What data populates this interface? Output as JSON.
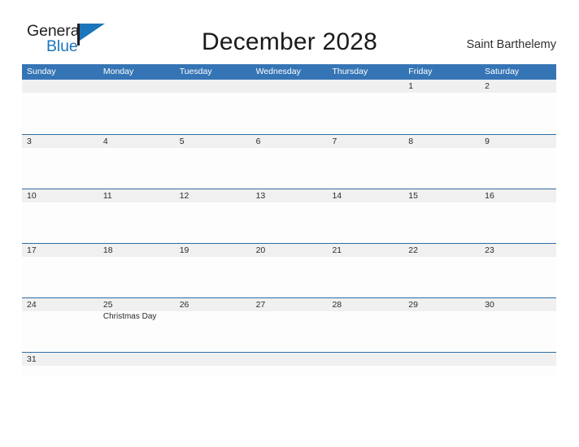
{
  "brand": {
    "name_part1": "General",
    "name_part2": "Blue",
    "flag_icon": "flag-icon",
    "accent_color": "#1b75bb",
    "text_color": "#231f20"
  },
  "header": {
    "title": "December 2028",
    "location": "Saint Barthelemy"
  },
  "calendar": {
    "month": "December",
    "year": "2028",
    "header_bg": "#3575b5",
    "band_bg": "#f0f0f0",
    "rule_color": "#2e6da4",
    "weekdays": [
      "Sunday",
      "Monday",
      "Tuesday",
      "Wednesday",
      "Thursday",
      "Friday",
      "Saturday"
    ],
    "weeks": [
      {
        "days": [
          {
            "num": "",
            "events": []
          },
          {
            "num": "",
            "events": []
          },
          {
            "num": "",
            "events": []
          },
          {
            "num": "",
            "events": []
          },
          {
            "num": "",
            "events": []
          },
          {
            "num": "1",
            "events": []
          },
          {
            "num": "2",
            "events": []
          }
        ]
      },
      {
        "days": [
          {
            "num": "3",
            "events": []
          },
          {
            "num": "4",
            "events": []
          },
          {
            "num": "5",
            "events": []
          },
          {
            "num": "6",
            "events": []
          },
          {
            "num": "7",
            "events": []
          },
          {
            "num": "8",
            "events": []
          },
          {
            "num": "9",
            "events": []
          }
        ]
      },
      {
        "days": [
          {
            "num": "10",
            "events": []
          },
          {
            "num": "11",
            "events": []
          },
          {
            "num": "12",
            "events": []
          },
          {
            "num": "13",
            "events": []
          },
          {
            "num": "14",
            "events": []
          },
          {
            "num": "15",
            "events": []
          },
          {
            "num": "16",
            "events": []
          }
        ]
      },
      {
        "days": [
          {
            "num": "17",
            "events": []
          },
          {
            "num": "18",
            "events": []
          },
          {
            "num": "19",
            "events": []
          },
          {
            "num": "20",
            "events": []
          },
          {
            "num": "21",
            "events": []
          },
          {
            "num": "22",
            "events": []
          },
          {
            "num": "23",
            "events": []
          }
        ]
      },
      {
        "days": [
          {
            "num": "24",
            "events": []
          },
          {
            "num": "25",
            "events": [
              "Christmas Day"
            ]
          },
          {
            "num": "26",
            "events": []
          },
          {
            "num": "27",
            "events": []
          },
          {
            "num": "28",
            "events": []
          },
          {
            "num": "29",
            "events": []
          },
          {
            "num": "30",
            "events": []
          }
        ]
      },
      {
        "short": true,
        "days": [
          {
            "num": "31",
            "events": []
          },
          {
            "num": "",
            "events": []
          },
          {
            "num": "",
            "events": []
          },
          {
            "num": "",
            "events": []
          },
          {
            "num": "",
            "events": []
          },
          {
            "num": "",
            "events": []
          },
          {
            "num": "",
            "events": []
          }
        ]
      }
    ]
  }
}
